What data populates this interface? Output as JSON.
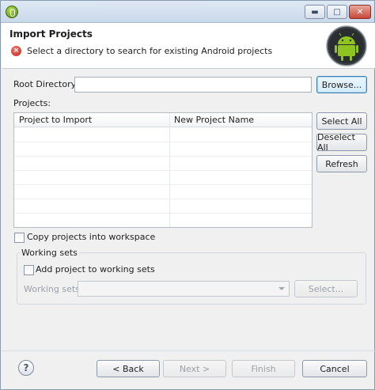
{
  "window": {
    "minimize_icon": "minimize-icon",
    "maximize_icon": "maximize-icon",
    "close_icon": "close-icon"
  },
  "header": {
    "title": "Import Projects",
    "message": "Select a directory to search for existing Android projects",
    "status_icon": "error-icon",
    "logo": "android-logo"
  },
  "root_directory": {
    "label": "Root Directory:",
    "value": "",
    "browse_label": "Browse..."
  },
  "projects": {
    "label": "Projects:",
    "columns": [
      "Project to Import",
      "New Project Name"
    ],
    "rows": [],
    "select_all_label": "Select All",
    "deselect_all_label": "Deselect All",
    "refresh_label": "Refresh"
  },
  "copy_into_workspace": {
    "label": "Copy projects into workspace",
    "checked": false
  },
  "working_sets": {
    "group_label": "Working sets",
    "add_label": "Add project to working sets",
    "add_checked": false,
    "field_label": "Working sets:",
    "field_value": "",
    "select_label": "Select..."
  },
  "footer": {
    "help_icon": "help-icon",
    "back_label": "< Back",
    "next_label": "Next >",
    "finish_label": "Finish",
    "cancel_label": "Cancel"
  },
  "colors": {
    "titlebar": "#c9d8ea",
    "header_bg": "#ffffff",
    "dialog_bg": "#f0f0f0",
    "focus_border": "#3c7fb1",
    "error_red": "#c0231b",
    "android_green": "#8fc31f"
  }
}
